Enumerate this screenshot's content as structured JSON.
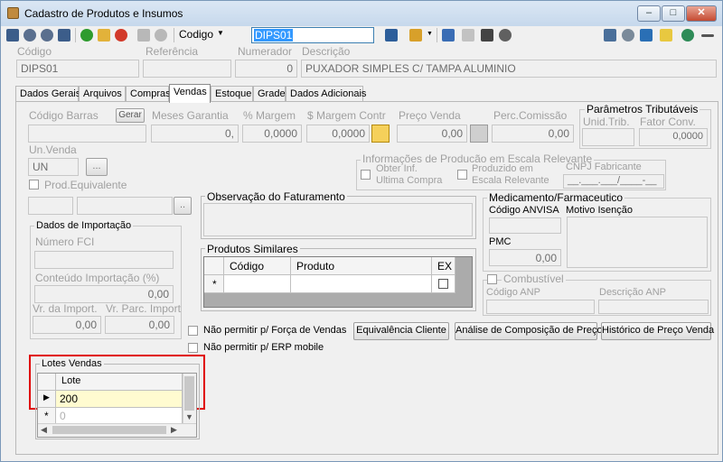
{
  "window": {
    "title": "Cadastro de Produtos e Insumos",
    "min": "‒",
    "max": "□",
    "close": "✕"
  },
  "toolbar": {
    "search_field_label": "Codigo",
    "search_value": "DIPS01"
  },
  "header": {
    "codigo_label": "Código",
    "codigo_value": "DIPS01",
    "referencia_label": "Referência",
    "referencia_value": "",
    "numerador_label": "Numerador",
    "numerador_value": "0",
    "descricao_label": "Descrição",
    "descricao_value": "PUXADOR SIMPLES C/ TAMPA ALUMINIO"
  },
  "tabs": [
    "Dados Gerais",
    "Arquivos",
    "Compras",
    "Vendas",
    "Estoque",
    "Grade",
    "Dados Adicionais"
  ],
  "vendas": {
    "codigo_barras_label": "Código Barras",
    "gerar_button": "Gerar",
    "meses_garantia_label": "Meses Garantia",
    "meses_garantia_value": "0,",
    "margem_pct_label": "% Margem",
    "margem_pct_value": "0,0000",
    "margem_contr_label": "$ Margem Contr",
    "margem_contr_value": "0,0000",
    "preco_venda_label": "Preço Venda",
    "preco_venda_value": "0,00",
    "perc_comissao_label": "Perc.Comissão",
    "perc_comissao_value": "0,00",
    "param_trib_title": "Parâmetros Tributáveis",
    "unid_trib_label": "Unid.Trib.",
    "fator_conv_label": "Fator Conv.",
    "fator_conv_value": "0,0000",
    "un_venda_label": "Un.Venda",
    "un_venda_value": "UN",
    "un_venda_button": "...",
    "prod_equivalente_label": "Prod.Equivalente",
    "equiv_button": "..",
    "info_escala_title": "Informações de Producão em Escala Relevante",
    "obter_inf_label": "Obter Inf.\nUltima Compra",
    "produzido_label": "Produzido em\nEscala Relevante",
    "cnpj_label": "CNPJ Fabricante",
    "cnpj_value": "__.___.___/____-__",
    "importacao_title": "Dados de Importação",
    "numero_fci_label": "Número FCI",
    "conteudo_import_label": "Conteúdo Importação (%)",
    "conteudo_import_value": "0,00",
    "vr_import_label": "Vr. da Import.",
    "vr_import_value": "0,00",
    "vr_parc_label": "Vr. Parc. Import",
    "vr_parc_value": "0,00",
    "observacao_title": "Observação do Faturamento",
    "similares_title": "Produtos Similares",
    "similares_columns": [
      "Código",
      "Produto",
      "EX"
    ],
    "medicamento_title": "Medicamento/Farmaceutico",
    "codigo_anvisa_label": "Código ANVISA",
    "motivo_isencao_label": "Motivo Isenção",
    "pmc_label": "PMC",
    "pmc_value": "0,00",
    "combustivel_label": "Combustível",
    "codigo_anp_label": "Código ANP",
    "descricao_anp_label": "Descrição ANP",
    "nao_forca_label": "Não permitir p/ Força de Vendas",
    "nao_erp_label": "Não permitir p/ ERP mobile",
    "equivalencia_button": "Equivalência Cliente",
    "analise_button": "Análise de Composição de Preço",
    "historico_button": "Histórico de Preço Venda",
    "lotes_title": "Lotes Vendas",
    "lotes_column": "Lote",
    "lotes_rows": [
      "200"
    ],
    "lotes_new_row": "0"
  },
  "colors": {
    "highlight": "#e00000",
    "selected_cell": "#fffbd0",
    "selection": "#3399ff"
  }
}
